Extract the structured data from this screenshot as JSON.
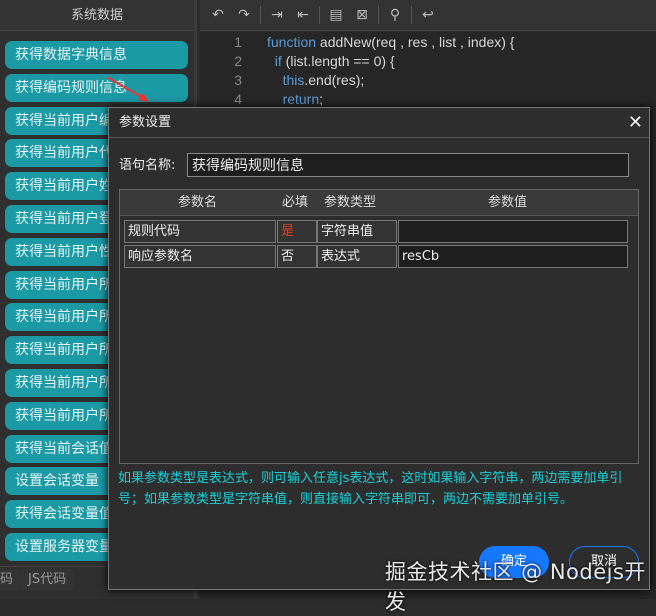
{
  "sidebar": {
    "title": "系统数据",
    "items": [
      "获得数据字典信息",
      "获得编码规则信息",
      "获得当前用户编",
      "获得当前用户代",
      "获得当前用户姓",
      "获得当前用户登",
      "获得当前用户性",
      "获得当前用户所",
      "获得当前用户所",
      "获得当前用户所",
      "获得当前用户所",
      "获得当前用户所",
      "获得当前会话值",
      "设置会话变量",
      "获得会话变量值",
      "设置服务器变量"
    ]
  },
  "bottom_tabs": [
    "码",
    "JS代码"
  ],
  "editor": {
    "lines": [
      {
        "n": "1",
        "indent": "",
        "kw": "function",
        "rest": " addNew(req , res , list , index) {"
      },
      {
        "n": "2",
        "indent": "  ",
        "kw": "if",
        "rest": " (list.length == 0) {"
      },
      {
        "n": "3",
        "indent": "    ",
        "kw": "this",
        "rest": ".end(res);"
      },
      {
        "n": "4",
        "indent": "    ",
        "kw": "return",
        "rest": ";"
      }
    ]
  },
  "modal": {
    "title": "参数设置",
    "name_label": "语句名称:",
    "name_value": "获得编码规则信息",
    "columns": [
      "参数名",
      "必填",
      "参数类型",
      "参数值"
    ],
    "rows": [
      {
        "name": "规则代码",
        "required": "是",
        "type": "字符串值",
        "value": ""
      },
      {
        "name": "响应参数名",
        "required": "否",
        "type": "表达式",
        "value": "resCb"
      }
    ],
    "hint": "如果参数类型是表达式，则可输入任意js表达式，这时如果输入字符串，两边需要加单引号；如果参数类型是字符串值，则直接输入字符串即可，两边不需要加单引号。",
    "ok": "确定",
    "cancel": "取消"
  },
  "watermark": "掘金技术社区 @ Nodejs开发",
  "colors": {
    "accent": "#1b9aa5",
    "required": "#e0401a",
    "hint": "#19d2d8",
    "primary": "#1677ff"
  }
}
